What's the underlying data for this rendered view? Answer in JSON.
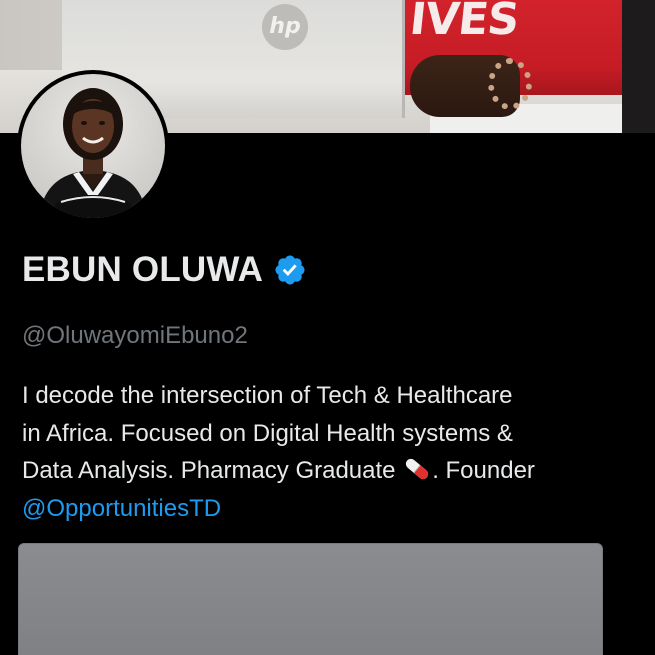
{
  "banner": {
    "laptop_brand": "hp",
    "shirt_text": "IVES"
  },
  "profile": {
    "display_name": "EBUN OLUWA",
    "verified": true,
    "handle": "@OluwayomiEbuno2",
    "bio": {
      "line1": "I decode the intersection of Tech & Healthcare",
      "line2": "in Africa. Focused on Digital Health systems &",
      "line3_before_emoji": "Data Analysis. Pharmacy Graduate ",
      "emoji": "pill-emoji",
      "line3_after_emoji": ". Founder",
      "mention": "@OpportunitiesTD"
    }
  },
  "colors": {
    "background": "#000000",
    "primary_text": "#e7e9ea",
    "secondary_text": "#71767b",
    "link": "#1d9bf0",
    "verified_badge": "#1d9bf0"
  }
}
